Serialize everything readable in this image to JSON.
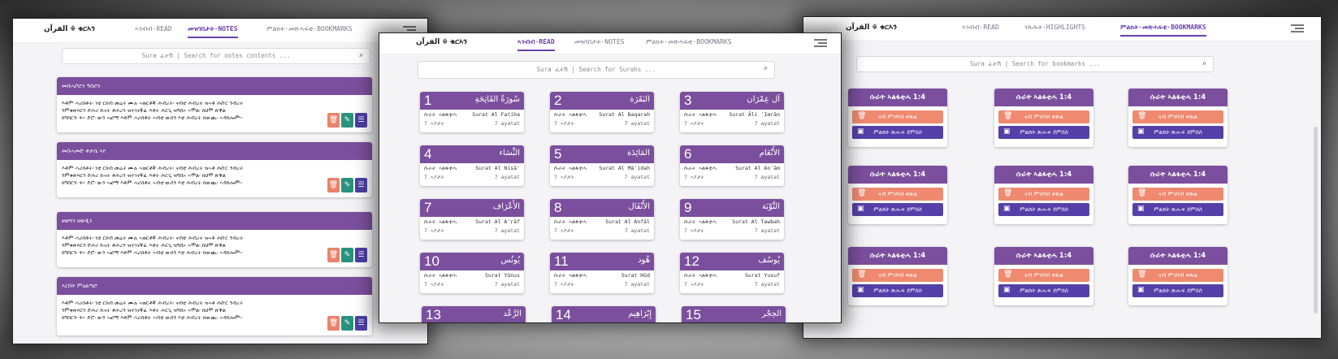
{
  "logo": "القرآن ☬ ቁርኣን",
  "notes_window": {
    "tabs": [
      {
        "label": "ኣንብብ·READ",
        "active": false
      },
      {
        "label": "መዝገበታት·NOTES",
        "active": true
      },
      {
        "label": "ምልክት·መጽሓፍቲ·BOOKMARKS",
        "active": false
      }
    ],
    "search_placeholder": "Sura ፈትሽ | Search for notes contents ...",
    "notes": [
      {
        "title": "መስሓቦሮን ዓስሮን",
        "body": [
          "እቶም ሓሪሰቶት፡ ነቲ ርክብ መሬት ሙሉ ኣወርቶኞ ሕብረት፡ ናብቲ ሕብረት ዝኣቶ ሕቡር ንብረት",
          "ንምቁጽጻርን ድሕሪ ኩናት ቶሕረን ዝተገናኞፈ እቶት ሕርጊ ዝግበኦ ኣሞል፡ ክህሞ ጽቕል",
          "ክግበርን፡ ፍ፦ ድሮ፡ ውን ኣፎማ እቶም ሓሪሰቶት ኣብቲ ውሰን እቲ ሕብረት ክውጪ፡ ኣዳኩሎም።"
        ]
      },
      {
        "title": "መስሓመድ ቀታሴ ኣየ",
        "body": [
          "እቶም ሓሪሰቶት፡ ነቲ ርክብ መሬት ሙሉ ኣወርቶኞ ሕብረት፡ ናብቲ ሕብረት ዝኣቶ ሕቡር ንብረት",
          "ንምቁጽጻርን ድሕሪ ኩናት ቶሕረን ዝተገናኞፈ እቶት ሕርጊ ዝግበኦ ኣሞል፡ ክህሞ ጽቕል",
          "ክግበርን፡ ፍ፦ ድሮ፡ ውን ኣፎማ እቶም ሓሪሰቶት ኣብቲ ውሰን እቲ ሕብረት ክውጪ፡ ኣዳኩሎም።"
        ]
      },
      {
        "title": "ዘወግን ዘወዲን",
        "body": [
          "እቶም ሓሪሰቶት፡ ነቲ ርክብ መሬት ሙሉ ኣወርቶኞ ሕብረት፡ ናብቲ ሕብረት ዝኣቶ ሕቡር ንብረት",
          "ንምቁጽጻርን ድሕሪ ኩናት ቶሕረን ዝተገናኞፈ እቶት ሕርጊ ዝግበኦ ኣሞል፡ ክህሞ ጽቕል",
          "ክግበርን፡ ፍ፦ ድሮ፡ ውን ኣፎማ እቶም ሓሪሰቶት ኣብቲ ውሰን እቲ ሕብረት ክውጪ፡ ኣዳኩሎም።"
        ]
      },
      {
        "title": "ኣርበት ምዕልጣሮ",
        "body": [
          "እቶም ሓሪሰቶት፡ ነቲ ርክብ መሬት ሙሉ ኣወርቶኞ ሕብረት፡ ናብቲ ሕብረት ዝኣቶ ሕቡር ንብረት",
          "ንምቁጽጻርን ድሕሪ ኩናት ቶሕረን ዝተገናኞፈ እቶት ሕርጊ ዝግበኦ ኣሞል፡ ክህሞ ጽቕል",
          "ክግበርን፡ ፍ፦ ድሮ፡ ውን ኣፎማ እቶም ሓሪሰቶት ኣብቲ ውሰን እቲ ሕብረት ክውጪ፡ ኣዳኩሎም።"
        ]
      }
    ],
    "icons": {
      "delete": "trash-icon",
      "edit": "edit-icon",
      "open": "book-icon"
    }
  },
  "read_window": {
    "tabs": [
      {
        "label": "ኣንብብ·READ",
        "active": true
      },
      {
        "label": "መዝገበታት·NOTES",
        "active": false
      },
      {
        "label": "ምልክት·መጽሓፍቲ·BOOKMARKS",
        "active": false
      }
    ],
    "search_placeholder": "Sura ፈትሽ | Search for Surahs ...",
    "card_label": "ሱራት ኣልፋቲሓ",
    "ayat_label_ti": "7 ኣያታት",
    "surahs": [
      {
        "num": "1",
        "arabic": "سُورَةُ الفَاتِحَةِ",
        "name": "Surat Al Fatiha",
        "ayat": "7 ayatat"
      },
      {
        "num": "2",
        "arabic": "البَقَرَة",
        "name": "Surat Al Baqarah",
        "ayat": "7 ayatat"
      },
      {
        "num": "3",
        "arabic": "آل عِمْرَان",
        "name": "Surat Āli ʿImrān",
        "ayat": "7 ayatat"
      },
      {
        "num": "4",
        "arabic": "النِّسَاء",
        "name": "Surat Al Nisāʾ",
        "ayat": "7 ayatat"
      },
      {
        "num": "5",
        "arabic": "المَائِدَة",
        "name": "Surat Al Māʾidah",
        "ayat": "7 ayatat"
      },
      {
        "num": "6",
        "arabic": "الأَنْعَام",
        "name": "Surat Al Anʿām",
        "ayat": "7 ayatat"
      },
      {
        "num": "7",
        "arabic": "الأَعْرَاف",
        "name": "Surat Al Aʿrāf",
        "ayat": "7 ayatat"
      },
      {
        "num": "8",
        "arabic": "الأَنْفَال",
        "name": "Surat Al Anfāl",
        "ayat": "7 ayatat"
      },
      {
        "num": "9",
        "arabic": "التَّوْبَة",
        "name": "Surat Al Tawbah",
        "ayat": "7 ayatat"
      },
      {
        "num": "10",
        "arabic": "يُونُس",
        "name": "Surat Yūnus",
        "ayat": "7 ayatat"
      },
      {
        "num": "11",
        "arabic": "هُود",
        "name": "Surat Hūd",
        "ayat": "7 ayatat"
      },
      {
        "num": "12",
        "arabic": "يُوسُف",
        "name": "Surat Yusuf",
        "ayat": "7 ayatat"
      },
      {
        "num": "13",
        "arabic": "الرَّعْد"
      },
      {
        "num": "14",
        "arabic": "إِبْرَاهِيم"
      },
      {
        "num": "15",
        "arabic": "الحِجْر"
      }
    ]
  },
  "bookmarks_window": {
    "tabs": [
      {
        "label": "ኣንብብ·READ",
        "active": false
      },
      {
        "label": "ንጹሕት·HIGHLIGHTS",
        "active": false
      },
      {
        "label": "ምልክት·መጽሓፍቲ·BOOKMARKS",
        "active": true
      }
    ],
    "search_placeholder": "Sura ፈትሽ | Search for bookmarks  ...",
    "card_title": "ሱራት ኣልፋቲሓ   1:4",
    "remove_label": "ናብ ምንባብ ቀጽል",
    "goto_label": "ምልክት ጽሑፍ ደምስስ",
    "count": 9
  }
}
